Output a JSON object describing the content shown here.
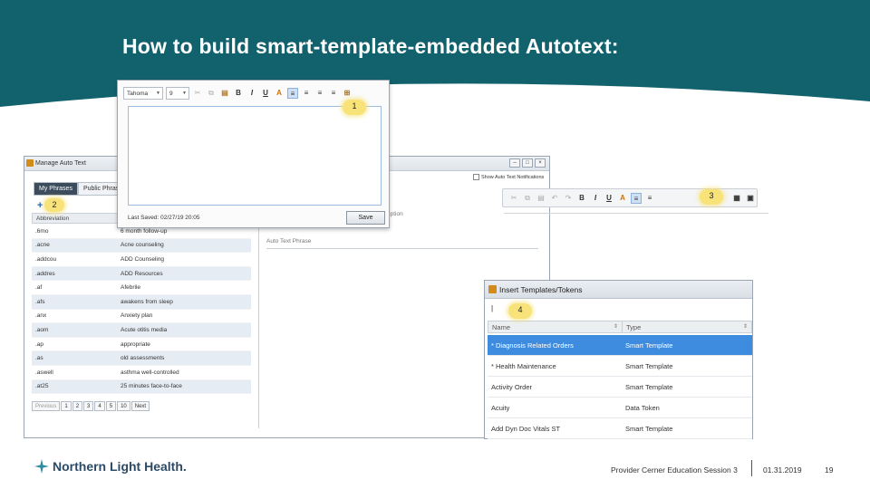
{
  "slide": {
    "title": "How to build smart-template-embedded Autotext:",
    "brand_color": "#12626e"
  },
  "manage_auto_text": {
    "title": "Manage Auto Text",
    "show_notifications": "Show Auto Text Notifications",
    "tabs": [
      "My Phrases",
      "Public Phrases"
    ],
    "column_header": "Abbreviation",
    "description_label": "ription",
    "auto_text_phrase_label": "Auto Text Phrase",
    "rows": [
      {
        "abbr": ".6mo",
        "desc": "6 month follow-up"
      },
      {
        "abbr": ".acne",
        "desc": "Acne counseling"
      },
      {
        "abbr": ".addcou",
        "desc": "ADD Counseling"
      },
      {
        "abbr": ".addres",
        "desc": "ADD Resources"
      },
      {
        "abbr": ".af",
        "desc": "Afebrile"
      },
      {
        "abbr": ".afs",
        "desc": "awakens from sleep"
      },
      {
        "abbr": ".anx",
        "desc": "Anxiety plan"
      },
      {
        "abbr": ".aom",
        "desc": "Acute otitis media"
      },
      {
        "abbr": ".ap",
        "desc": "appropriate"
      },
      {
        "abbr": ".as",
        "desc": "old assessments"
      },
      {
        "abbr": ".aswell",
        "desc": "asthma well-controlled"
      },
      {
        "abbr": ".at25",
        "desc": "25 minutes face-to-face"
      }
    ],
    "pager": {
      "previous": "Previous",
      "pages": [
        "1",
        "2",
        "3",
        "4",
        "5",
        "10"
      ],
      "next": "Next"
    }
  },
  "editor": {
    "font": "Tahoma",
    "size": "9",
    "last_saved": "Last Saved: 02/27/19 20:05",
    "save_label": "Save"
  },
  "callouts": {
    "one": "1",
    "two": "2",
    "three": "3",
    "four": "4"
  },
  "insert_templates": {
    "title": "Insert Templates/Tokens",
    "search_value": "|",
    "col_name": "Name",
    "col_type": "Type",
    "rows": [
      {
        "name": "* Diagnosis Related Orders",
        "type": "Smart Template",
        "selected": true
      },
      {
        "name": "* Health Maintenance",
        "type": "Smart Template"
      },
      {
        "name": "Activity Order",
        "type": "Smart Template"
      },
      {
        "name": "Acuity",
        "type": "Data Token"
      },
      {
        "name": "Add Dyn Doc Vitals ST",
        "type": "Smart Template"
      }
    ],
    "selected_color": "#3e8ce0"
  },
  "footer": {
    "logo": "Northern Light Health.",
    "session": "Provider Cerner Education Session 3",
    "date": "01.31.2019",
    "page": "19"
  }
}
